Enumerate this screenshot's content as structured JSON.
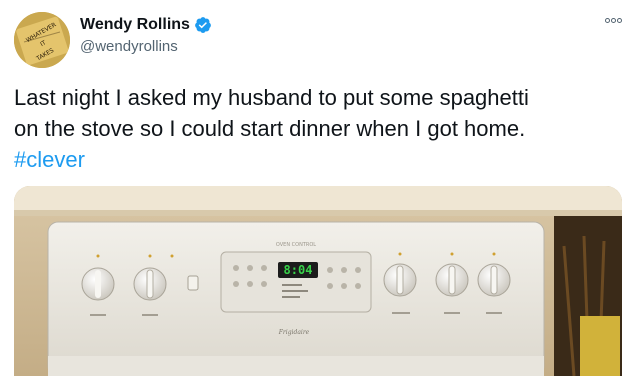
{
  "user": {
    "display_name": "Wendy Rollins",
    "handle": "@wendyrollins",
    "verified": true,
    "avatar_text": "WHATEVER IT TAKES"
  },
  "tweet": {
    "line1": "Last night I asked my husband to put some spaghetti",
    "line2": "on the stove so I could start dinner when I got home.",
    "hashtag": "#clever"
  },
  "media": {
    "clock_display": "8:04",
    "stove_brand": "Frigidaire"
  },
  "icons": {
    "more": "more-options-icon",
    "verified": "verified-badge-icon"
  },
  "colors": {
    "link": "#1d9bf0",
    "secondary_text": "#536471",
    "verified_blue": "#1d9bf0"
  }
}
